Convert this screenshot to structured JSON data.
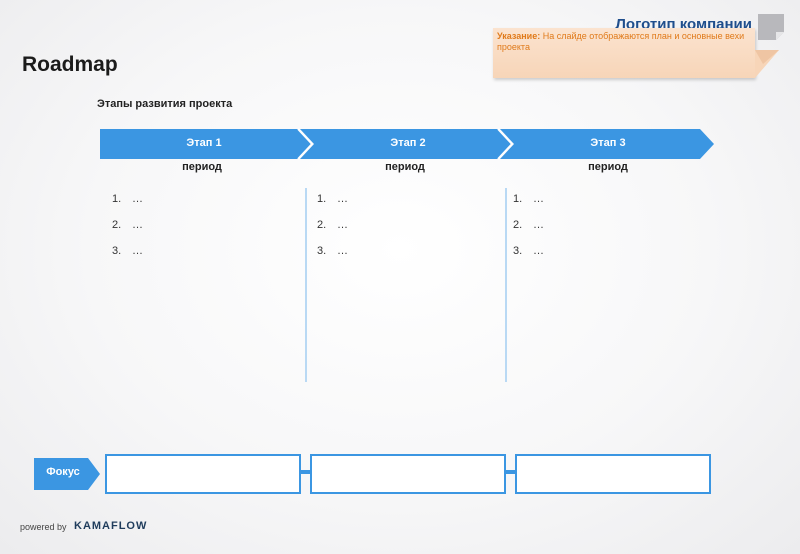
{
  "header": {
    "logo_text": "Логотип компании",
    "title": "Roadmap"
  },
  "note": {
    "label": "Указание:",
    "text": "На слайде отображаются план и основные вехи проекта"
  },
  "stages_heading": "Этапы развития проекта",
  "stages": [
    {
      "label": "Этап 1",
      "period": "период",
      "items": [
        "…",
        "…",
        "…"
      ]
    },
    {
      "label": "Этап 2",
      "period": "период",
      "items": [
        "…",
        "…",
        "…"
      ]
    },
    {
      "label": "Этап 3",
      "period": "период",
      "items": [
        "…",
        "…",
        "…"
      ]
    }
  ],
  "list_numbers": [
    "1.",
    "2.",
    "3."
  ],
  "focus": {
    "label": "Фокус",
    "values": [
      "",
      "",
      ""
    ]
  },
  "footer": {
    "powered_by": "powered by",
    "brand": "KAMAFLOW"
  },
  "colors": {
    "accent": "#3b96e2",
    "note_bg": "#f7d5b8",
    "note_text": "#e07a1a",
    "logo_text": "#1f4e8c"
  }
}
